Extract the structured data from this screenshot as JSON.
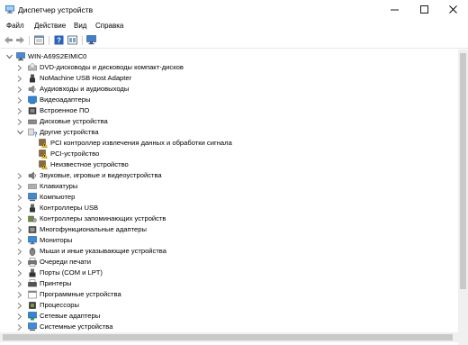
{
  "window": {
    "title": "Диспетчер устройств"
  },
  "menu": [
    "Файл",
    "Действие",
    "Вид",
    "Справка"
  ],
  "toolbar": {
    "buttons": [
      "back-arrow-icon",
      "forward-arrow-icon",
      "properties-icon",
      "help-icon",
      "view-icon",
      "monitor-icon"
    ]
  },
  "tree": {
    "root": "WIN-A69S2EIMIC0",
    "items": [
      {
        "label": "DVD-дисководы и дисководы компакт-дисков",
        "icon": "dvd-drive-icon",
        "expanded": false
      },
      {
        "label": "NoMachine USB Host Adapter",
        "icon": "usb-adapter-icon",
        "expanded": false
      },
      {
        "label": "Аудиовходы и аудиовыходы",
        "icon": "speaker-icon",
        "expanded": false
      },
      {
        "label": "Видеоадаптеры",
        "icon": "display-adapter-icon",
        "expanded": false
      },
      {
        "label": "Встроенное ПО",
        "icon": "firmware-icon",
        "expanded": false
      },
      {
        "label": "Дисковые устройства",
        "icon": "disk-drive-icon",
        "expanded": false
      },
      {
        "label": "Другие устройства",
        "icon": "other-devices-icon",
        "expanded": true,
        "children": [
          {
            "label": "PCI контроллер извлечения данных и обработки сигнала",
            "icon": "warning-device-icon"
          },
          {
            "label": "PCI-устройство",
            "icon": "warning-device-icon"
          },
          {
            "label": "Неизвестное устройство",
            "icon": "warning-device-icon"
          }
        ]
      },
      {
        "label": "Звуковые, игровые и видеоустройства",
        "icon": "sound-icon",
        "expanded": false
      },
      {
        "label": "Клавиатуры",
        "icon": "keyboard-icon",
        "expanded": false
      },
      {
        "label": "Компьютер",
        "icon": "computer-icon",
        "expanded": false
      },
      {
        "label": "Контроллеры USB",
        "icon": "usb-controller-icon",
        "expanded": false
      },
      {
        "label": "Контроллеры запоминающих устройств",
        "icon": "storage-controller-icon",
        "expanded": false
      },
      {
        "label": "Многофункциональные адаптеры",
        "icon": "multifunction-icon",
        "expanded": false
      },
      {
        "label": "Мониторы",
        "icon": "monitor-icon",
        "expanded": false
      },
      {
        "label": "Мыши и иные указывающие устройства",
        "icon": "mouse-icon",
        "expanded": false
      },
      {
        "label": "Очереди печати",
        "icon": "print-queue-icon",
        "expanded": false
      },
      {
        "label": "Порты (COM и LPT)",
        "icon": "port-icon",
        "expanded": false
      },
      {
        "label": "Принтеры",
        "icon": "printer-icon",
        "expanded": false
      },
      {
        "label": "Программные устройства",
        "icon": "software-device-icon",
        "expanded": false
      },
      {
        "label": "Процессоры",
        "icon": "processor-icon",
        "expanded": false
      },
      {
        "label": "Сетевые адаптеры",
        "icon": "network-adapter-icon",
        "expanded": false
      },
      {
        "label": "Системные устройства",
        "icon": "system-device-icon",
        "expanded": false
      }
    ]
  },
  "colors": {
    "accent_blue": "#1e78c8",
    "warning_yellow": "#f2c200",
    "scrollbar": "#c9c9c9"
  }
}
